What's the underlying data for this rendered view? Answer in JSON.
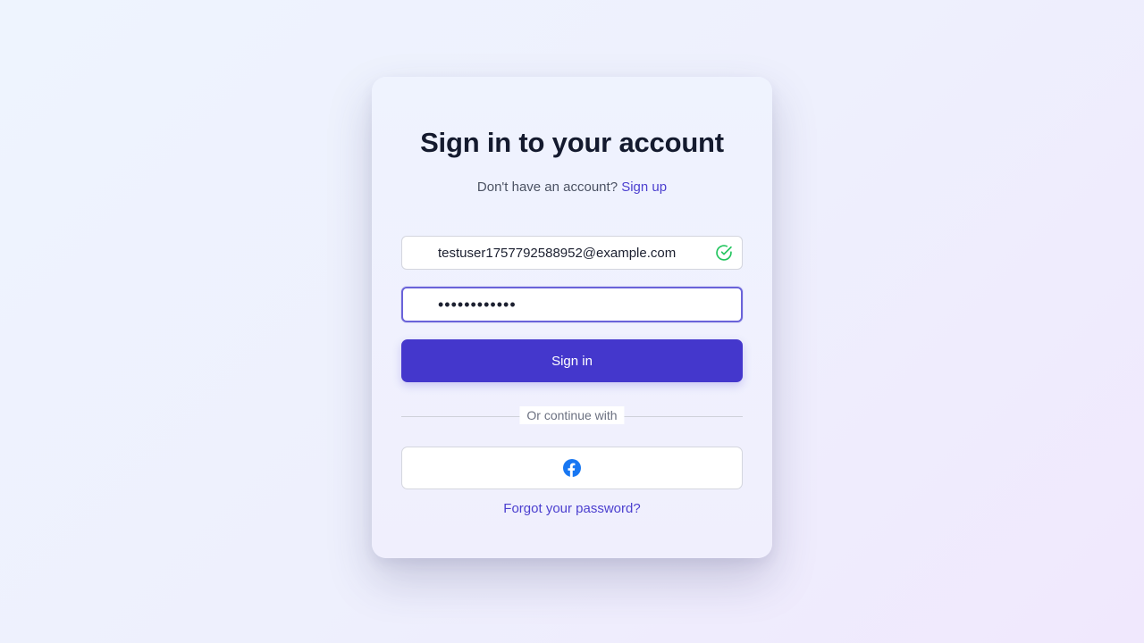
{
  "login": {
    "title": "Sign in to your account",
    "signup_prompt": "Don't have an account?",
    "signup_link": "Sign up",
    "email_value": "testuser1757792588952@example.com",
    "password_value": "••••••••••••",
    "submit_label": "Sign in",
    "divider_text": "Or continue with",
    "social_icon": "facebook-icon",
    "forgot_link": "Forgot your password?"
  },
  "colors": {
    "primary": "#4437cc",
    "link": "#4b3fcf",
    "focus_border": "#6a63d9",
    "valid": "#22c55e",
    "facebook": "#1877f2"
  }
}
